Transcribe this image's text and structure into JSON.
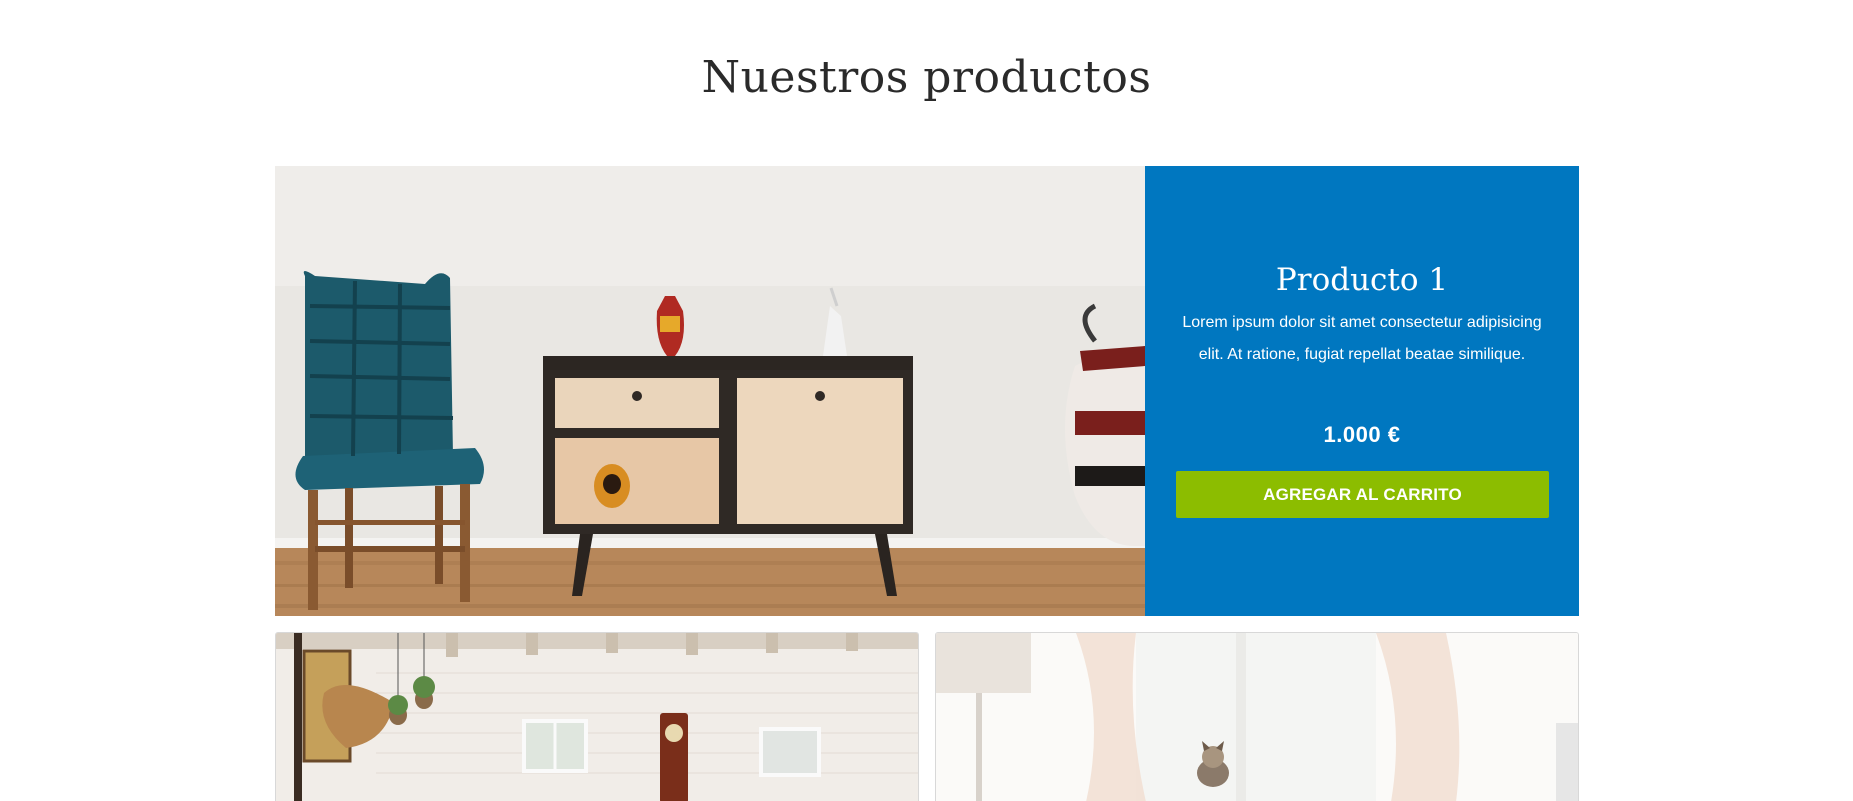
{
  "section": {
    "title": "Nuestros productos"
  },
  "featured_product": {
    "name": "Producto 1",
    "description": "Lorem ipsum dolor sit amet consectetur adipisicing elit. At ratione, fugiat repellat beatae similique.",
    "price": "1.000 €",
    "button_label": "AGREGAR AL CARRITO",
    "image": "product-photo-chair-sideboard"
  },
  "product_cards": [
    {
      "image": "product-photo-living-room"
    },
    {
      "image": "product-photo-window-cat"
    }
  ],
  "colors": {
    "info_panel": "#0077c0",
    "cart_button": "#8cbd00",
    "title_text": "#2a2a2a"
  }
}
